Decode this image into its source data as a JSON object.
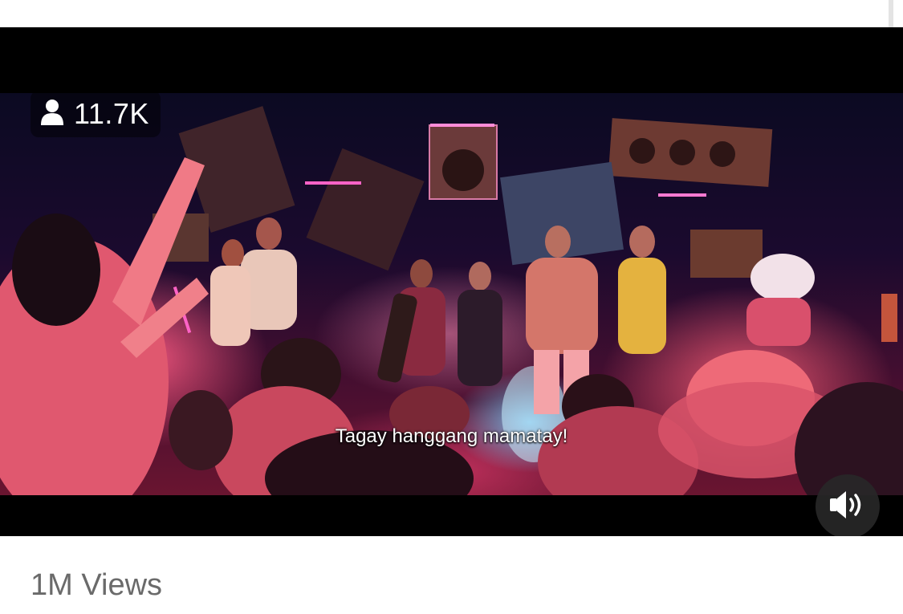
{
  "viewer_badge": {
    "icon": "person-icon",
    "count": "11.7K"
  },
  "video": {
    "subtitle": "Tagay hanggang mamatay!"
  },
  "controls": {
    "volume_icon": "speaker-volume-icon"
  },
  "footer": {
    "views": "1M Views"
  },
  "colors": {
    "player_bg": "#000000",
    "views_text": "#6a6a6a",
    "badge_text": "#ffffff"
  }
}
